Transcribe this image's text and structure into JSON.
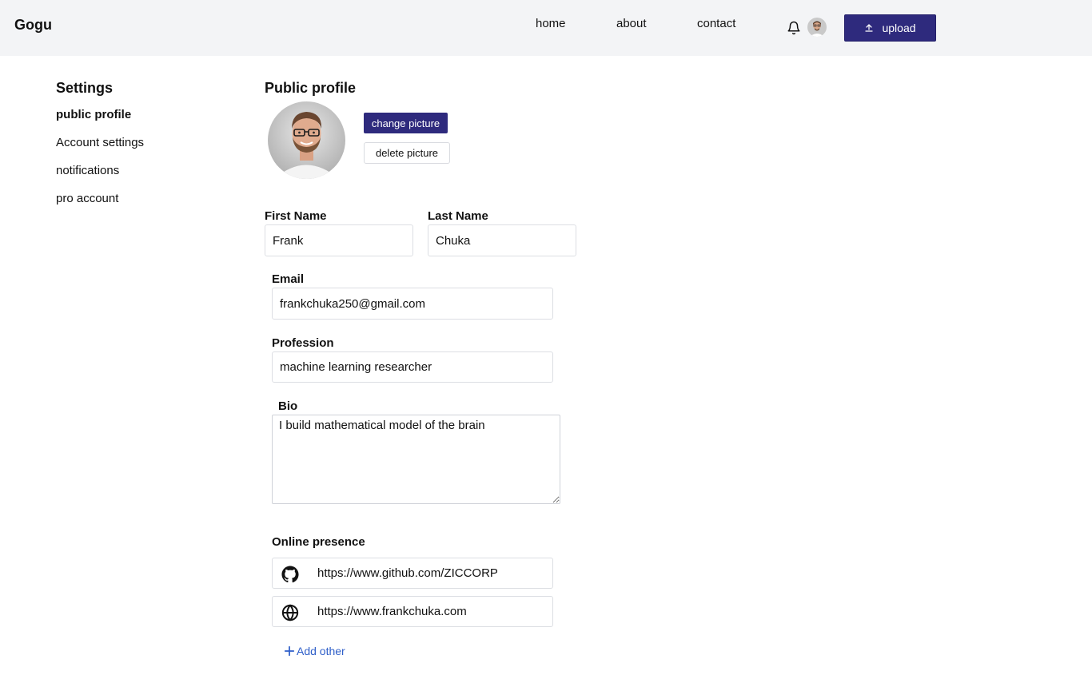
{
  "header": {
    "brand": "Gogu",
    "nav": {
      "home": "home",
      "about": "about",
      "contact": "contact"
    },
    "upload_label": "upload",
    "icons": {
      "notifications": "bell-icon",
      "upload": "upload-icon",
      "avatar": "avatar"
    }
  },
  "sidebar": {
    "title": "Settings",
    "items": [
      {
        "label": "public profile",
        "active": true
      },
      {
        "label": "Account settings",
        "active": false
      },
      {
        "label": "notifications",
        "active": false
      },
      {
        "label": "pro account",
        "active": false
      }
    ]
  },
  "profile": {
    "title": "Public profile",
    "change_picture_label": "change picture",
    "delete_picture_label": "delete picture",
    "first_name": {
      "label": "First Name",
      "value": "Frank"
    },
    "last_name": {
      "label": "Last Name",
      "value": "Chuka"
    },
    "email": {
      "label": "Email",
      "value": "frankchuka250@gmail.com"
    },
    "profession": {
      "label": "Profession",
      "value": "machine learning researcher"
    },
    "bio": {
      "label": "Bio",
      "value": "I build mathematical model of the brain"
    }
  },
  "online_presence": {
    "title": "Online presence",
    "links": [
      {
        "icon": "github-icon",
        "value": "https://www.github.com/ZICCORP"
      },
      {
        "icon": "globe-icon",
        "value": "https://www.frankchuka.com"
      }
    ],
    "add_other_label": "Add other"
  },
  "colors": {
    "primary": "#2e2a7d",
    "header_bg": "#f3f4f6",
    "link": "#2f5fc9"
  }
}
